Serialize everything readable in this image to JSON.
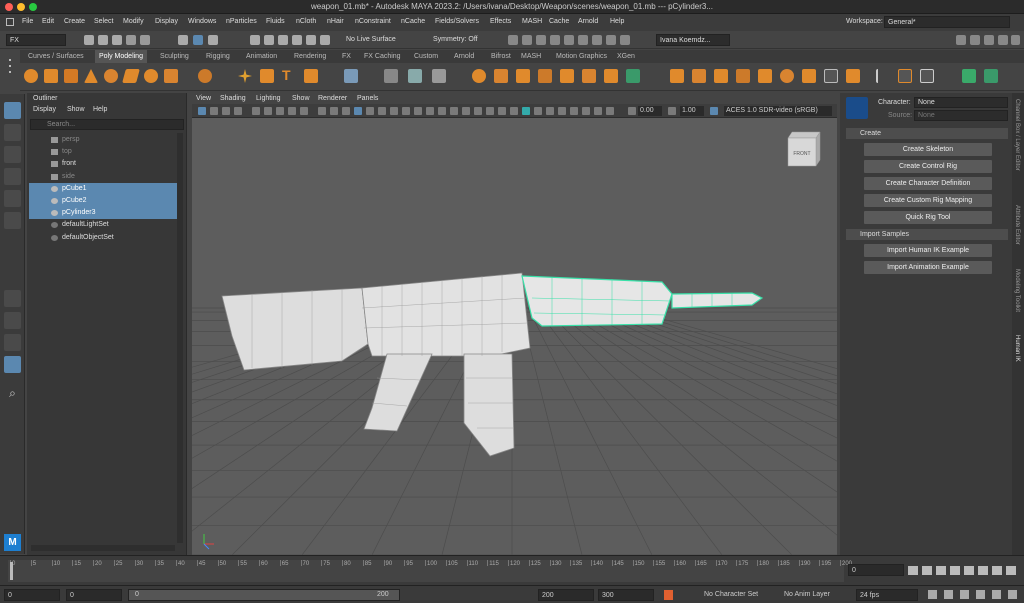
{
  "window": {
    "title": "weapon_01.mb* - Autodesk MAYA 2023.2: /Users/ivana/Desktop/Weapon/scenes/weapon_01.mb  ---  pCylinder3..."
  },
  "menubar": {
    "items": [
      "File",
      "Edit",
      "Create",
      "Select",
      "Modify",
      "Display",
      "Windows",
      "nParticles",
      "Fluids",
      "nCloth",
      "nHair",
      "nConstraint",
      "nCache",
      "Fields/Solvers",
      "Effects",
      "MASH",
      "Cache",
      "Arnold",
      "Help"
    ],
    "workspace_label": "Workspace:",
    "workspace_value": "General*"
  },
  "statusline": {
    "menuset": "FX",
    "live_surface": "No Live Surface",
    "symmetry": "Symmetry: Off",
    "user": "Ivana Koemdz..."
  },
  "shelf": {
    "tabs": [
      "Curves / Surfaces",
      "Poly Modeling",
      "Sculpting",
      "Rigging",
      "Animation",
      "Rendering",
      "FX",
      "FX Caching",
      "Custom",
      "Arnold",
      "Bifrost",
      "MASH",
      "Motion Graphics",
      "XGen"
    ],
    "active_tab": "Poly Modeling"
  },
  "outliner": {
    "title": "Outliner",
    "menu": [
      "Display",
      "Show",
      "Help"
    ],
    "search_placeholder": "Search...",
    "items": [
      {
        "label": "persp",
        "type": "camera",
        "state": "hidden"
      },
      {
        "label": "top",
        "type": "camera",
        "state": "hidden"
      },
      {
        "label": "front",
        "type": "camera",
        "state": "normal"
      },
      {
        "label": "side",
        "type": "camera",
        "state": "hidden"
      },
      {
        "label": "pCube1",
        "type": "mesh",
        "state": "selected"
      },
      {
        "label": "pCube2",
        "type": "mesh",
        "state": "selected"
      },
      {
        "label": "pCylinder3",
        "type": "mesh",
        "state": "selected"
      },
      {
        "label": "defaultLightSet",
        "type": "set",
        "state": "normal"
      },
      {
        "label": "defaultObjectSet",
        "type": "set",
        "state": "normal"
      }
    ]
  },
  "viewport": {
    "menu": [
      "View",
      "Shading",
      "Lighting",
      "Show",
      "Renderer",
      "Panels"
    ],
    "exposure": "0.00",
    "gamma": "1.00",
    "color_space": "ACES 1.0 SDR-video (sRGB)",
    "viewcube_label": "FRONT"
  },
  "hik": {
    "character_label": "Character:",
    "character_value": "None",
    "source_label": "Source:",
    "source_value": "None",
    "create_section": "Create",
    "create_buttons": [
      "Create Skeleton",
      "Create Control Rig",
      "Create Character Definition",
      "Create Custom Rig Mapping",
      "Quick Rig Tool"
    ],
    "import_section": "Import Samples",
    "import_buttons": [
      "Import Human IK Example",
      "Import Animation Example"
    ]
  },
  "side_tabs": [
    "Channel Box / Layer Editor",
    "Attribute Editor",
    "Modeling Toolkit",
    "Human IK"
  ],
  "timeline": {
    "ticks": [
      "0",
      "5",
      "10",
      "15",
      "20",
      "25",
      "30",
      "35",
      "40",
      "45",
      "50",
      "55",
      "60",
      "65",
      "70",
      "75",
      "80",
      "85",
      "90",
      "95",
      "100",
      "105",
      "110",
      "115",
      "120",
      "125",
      "130",
      "135",
      "140",
      "145",
      "150",
      "155",
      "160",
      "165",
      "170",
      "175",
      "180",
      "185",
      "190",
      "195",
      "200"
    ],
    "current_frame": "0"
  },
  "range": {
    "start": "0",
    "playback_start": "0",
    "slider_start": "0",
    "slider_end": "200",
    "playback_end": "200",
    "end": "300",
    "character_set": "No Character Set",
    "anim_layer": "No Anim Layer",
    "fps": "24 fps"
  },
  "colors": {
    "selection": "#5b88b0",
    "highlight_mesh": "#39e0a8",
    "viewport_bg": "#5d5d5d",
    "shelf_orange": "#e08a2c"
  }
}
